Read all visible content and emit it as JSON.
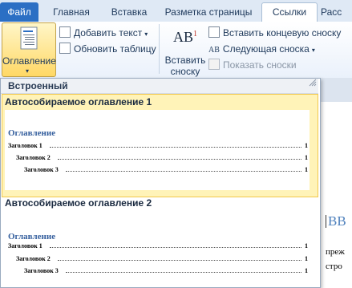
{
  "tabs": [
    "Файл",
    "Главная",
    "Вставка",
    "Разметка страницы",
    "Ссылки",
    "Расс"
  ],
  "ribbon": {
    "toc_label": "Оглавление",
    "add_text": "Добавить текст",
    "update_table": "Обновить таблицу",
    "insert_footnote_1": "Вставить",
    "insert_footnote_2": "сноску",
    "insert_endnote": "Вставить концевую сноску",
    "next_footnote": "Следующая сноска",
    "show_notes": "Показать сноски",
    "ab_label": "AB",
    "ab_sup": "1"
  },
  "gallery": {
    "header": "Встроенный",
    "item1": {
      "title": "Автособираемое оглавление 1",
      "heading": "Оглавление",
      "rows": [
        {
          "label": "Заголовок 1",
          "page": "1"
        },
        {
          "label": "Заголовок 2",
          "page": "1"
        },
        {
          "label": "Заголовок 3",
          "page": "1"
        }
      ]
    },
    "item2": {
      "title": "Автособираемое оглавление 2",
      "heading": "Оглавление",
      "rows": [
        {
          "label": "Заголовок 1",
          "page": "1"
        },
        {
          "label": "Заголовок 2",
          "page": "1"
        },
        {
          "label": "Заголовок 3",
          "page": "1"
        }
      ]
    }
  },
  "document": {
    "heading_fragment": "ВВ",
    "line1": "преж",
    "line2": "стро"
  },
  "colors": {
    "file_tab": "#2b6fc4",
    "selected_item": "#fff3b8",
    "toc_heading": "#36609e"
  }
}
